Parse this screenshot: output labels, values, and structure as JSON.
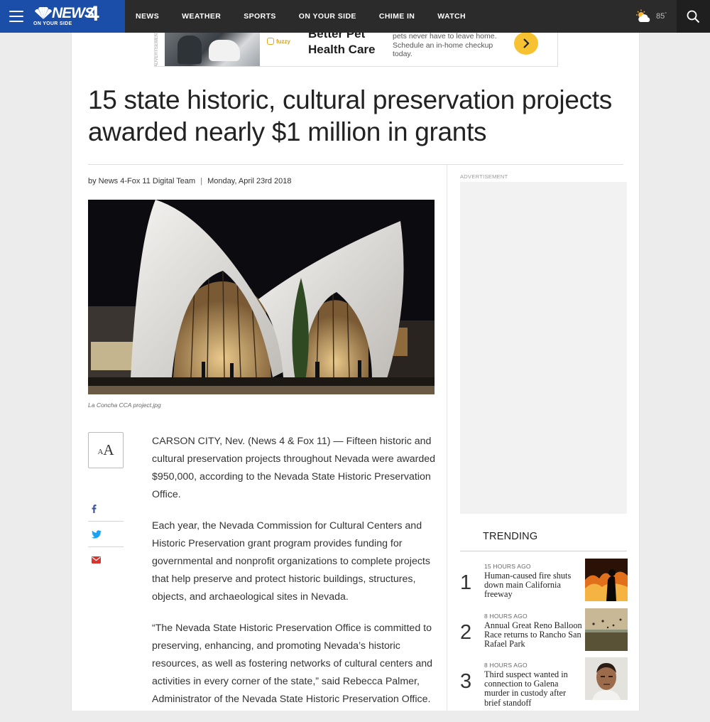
{
  "header": {
    "brand": "NEWS",
    "brand_number": "4",
    "tagline": "ON YOUR SIDE",
    "nav": [
      "NEWS",
      "WEATHER",
      "SPORTS",
      "ON YOUR SIDE",
      "CHIME IN",
      "WATCH"
    ],
    "temperature": "85",
    "degree": "°"
  },
  "ad_banner": {
    "label": "ADVERTISEMENT",
    "sponsor": "fuzzy",
    "headline": "Better Pet Health Care",
    "body": "pets never have to leave home. Schedule an in-home checkup today.",
    "cta": "›"
  },
  "article": {
    "title": "15 state historic, cultural preservation projects awarded nearly $1 million in grants",
    "byline": "by News 4-Fox 11 Digital Team",
    "byline_sep": "|",
    "date": "Monday, April 23rd 2018",
    "caption": "La Concha CCA project.jpg",
    "font_tool_small": "A",
    "font_tool_big": "A",
    "paragraphs": [
      "CARSON CITY, Nev. (News 4 & Fox 11) — Fifteen historic and cultural preservation projects throughout Nevada were awarded $950,000, according to the Nevada State Historic Preservation Office.",
      "Each year, the Nevada Commission for Cultural Centers and Historic Preservation grant program provides funding for governmental and nonprofit organizations to complete projects that help preserve and protect historic buildings, structures, objects, and archaeological sites in Nevada.",
      "“The Nevada State Historic Preservation Office is committed to preserving, enhancing, and promoting Nevada’s historic resources, as well as fostering networks of cultural centers and activities in every corner of the state,” said Rebecca Palmer, Administrator of the Nevada State Historic Preservation Office."
    ]
  },
  "sidebar": {
    "ad_label": "ADVERTISEMENT",
    "trending_title": "TRENDING",
    "trending": [
      {
        "rank": "1",
        "time": "15 HOURS AGO",
        "headline": "Human-caused fire shuts down main California freeway"
      },
      {
        "rank": "2",
        "time": "8 HOURS AGO",
        "headline": "Annual Great Reno Balloon Race returns to Rancho San Rafael Park"
      },
      {
        "rank": "3",
        "time": "8 HOURS AGO",
        "headline": "Third suspect wanted in connection to Galena murder in custody after brief standoff"
      }
    ]
  },
  "colors": {
    "logo_blue": "#1b4ea8",
    "header_bg": "#2b2b2b",
    "ad_cta": "#f6c231",
    "facebook": "#3b5998",
    "twitter": "#1da1f2",
    "email": "#d9352f"
  }
}
